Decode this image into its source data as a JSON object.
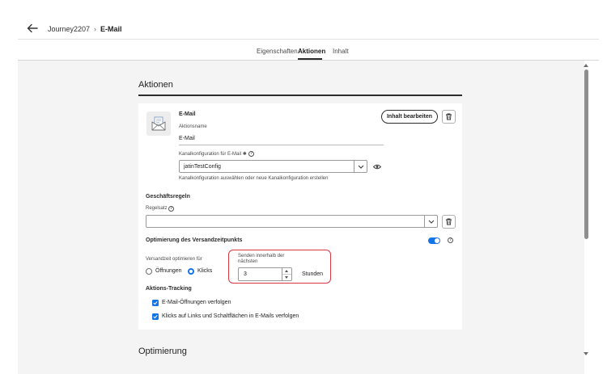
{
  "header": {
    "breadcrumb_parent": "Journey2207",
    "breadcrumb_separator": "›",
    "breadcrumb_current": "E-Mail"
  },
  "tabs": [
    {
      "label": "Eigenschaften",
      "active": false
    },
    {
      "label": "Aktionen",
      "active": true
    },
    {
      "label": "Inhalt",
      "active": false
    }
  ],
  "section": {
    "title": "Aktionen"
  },
  "action": {
    "type_title": "E-Mail",
    "name_label": "Aktionsname",
    "name_value": "E-Mail",
    "edit_button": "Inhalt bearbeiten",
    "channel_label": "Kanalkonfiguration für E-Mail ✱",
    "channel_value": "jatinTestConfig",
    "channel_help": "Kanalkonfiguration auswählen oder neue Kanalkonfiguration erstellen"
  },
  "rules": {
    "title": "Geschäftsregeln",
    "ruleset_label": "Regelsatz",
    "ruleset_value": ""
  },
  "send_time": {
    "title": "Optimierung des Versandzeitpunkts",
    "enabled": true,
    "optimize_for_label": "Versandzeit optimieren für",
    "options": [
      {
        "label": "Öffnungen",
        "selected": false
      },
      {
        "label": "Klicks",
        "selected": true
      }
    ],
    "window_label_line1": "Senden innerhalb der",
    "window_label_line2": "nächsten",
    "window_value": "3",
    "window_unit": "Stunden"
  },
  "tracking": {
    "title": "Aktions-Tracking",
    "items": [
      {
        "label": "E-Mail-Öffnungen verfolgen",
        "checked": true
      },
      {
        "label": "Klicks auf Links und Schaltflächen in E-Mails verfolgen",
        "checked": true
      }
    ]
  },
  "next_section": {
    "title": "Optimierung"
  },
  "colors": {
    "accent": "#1473e6",
    "highlight": "#d7373f",
    "background": "#f4f4f4"
  }
}
